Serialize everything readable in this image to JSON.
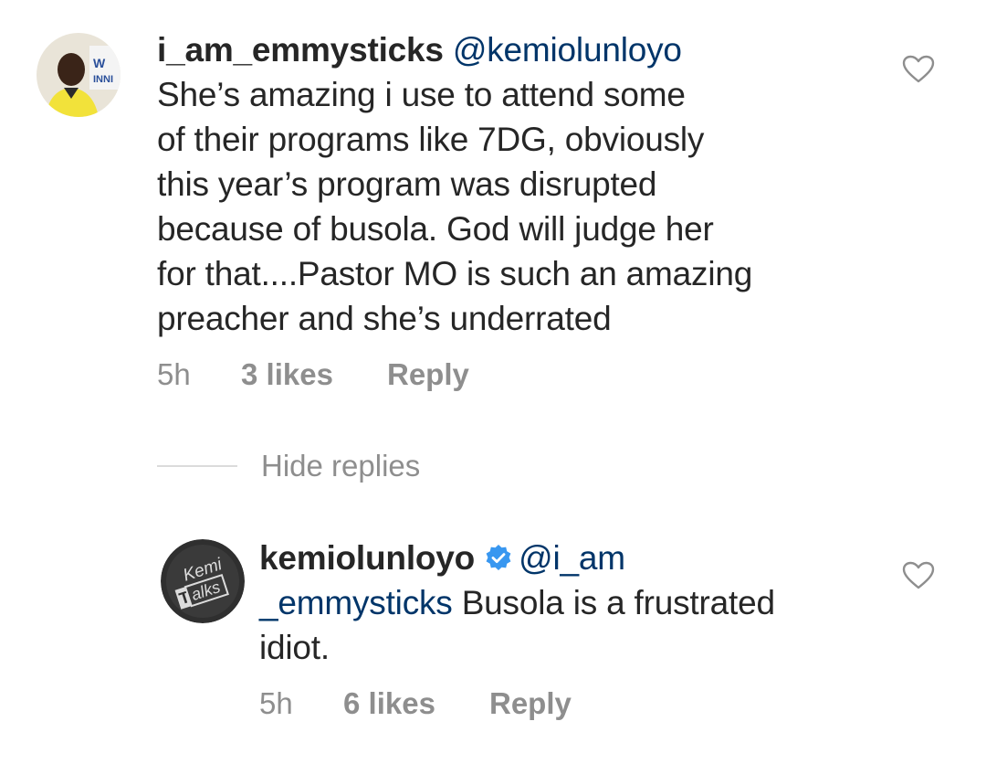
{
  "comments": [
    {
      "username": "i_am_emmysticks",
      "mention": "@kemiolunloyo",
      "text_lines": [
        "She’s amazing i use to attend some",
        "of their programs like 7DG, obviously",
        "this year’s program was disrupted",
        "because of busola. God will judge her",
        "for that....Pastor MO is such an amazing",
        "preacher and she’s underrated"
      ],
      "time": "5h",
      "likes": "3 likes",
      "reply_label": "Reply",
      "avatar_icon": "profile-photo-man-yellow-shirt"
    }
  ],
  "hide_replies_label": "Hide replies",
  "reply": {
    "username": "kemiolunloyo",
    "verified": true,
    "mention_part1": "@i_am",
    "mention_part2": "_emmysticks",
    "text_part1": " Busola is a frustrated",
    "text_line3": "idiot.",
    "time": "5h",
    "likes": "6 likes",
    "reply_label": "Reply",
    "avatar_text_1": "Kemi",
    "avatar_text_2": "alks",
    "avatar_icon": "kemi-talks-logo"
  },
  "colors": {
    "mention": "#003569",
    "muted": "#8e8e8e",
    "verified_badge": "#3897f0"
  }
}
